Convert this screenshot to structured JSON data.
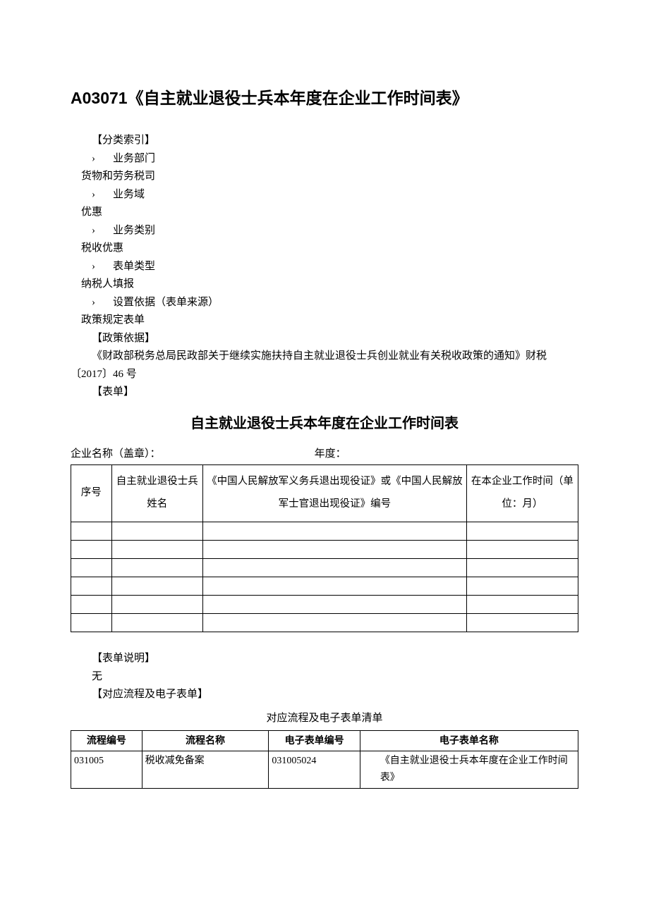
{
  "title": "A03071《自主就业退役士兵本年度在企业工作时间表》",
  "index": {
    "label": "【分类索引】",
    "items": [
      {
        "chev": "›",
        "head": "业务部门",
        "value": "货物和劳务税司"
      },
      {
        "chev": "›",
        "head": "业务域",
        "value": "优惠"
      },
      {
        "chev": "›",
        "head": "业务类别",
        "value": "税收优惠"
      },
      {
        "chev": "›",
        "head": "表单类型",
        "value": "纳税人填报"
      },
      {
        "chev": "›",
        "head": "设置依据（表单来源）",
        "value": "政策规定表单"
      }
    ]
  },
  "policy": {
    "label": "【政策依据】",
    "text": "《财政部税务总局民政部关于继续实施扶持自主就业退役士兵创业就业有关税收政策的通知》财税〔2017〕46 号"
  },
  "form_label": "【表单】",
  "form": {
    "title": "自主就业退役士兵本年度在企业工作时间表",
    "meta_left": "企业名称（盖章）：",
    "meta_right": "年度：",
    "headers": {
      "c1": "序号",
      "c2": "自主就业退役士兵姓名",
      "c3": "《中国人民解放军义务兵退出现役证》或《中国人民解放军士官退出现役证》编号",
      "c4": "在本企业工作时间（单位：月）"
    },
    "empty_rows": 6
  },
  "desc": {
    "label": "【表单说明】",
    "text": "无"
  },
  "mapping": {
    "label": "【对应流程及电子表单】",
    "title": "对应流程及电子表单清单",
    "headers": {
      "h1": "流程编号",
      "h2": "流程名称",
      "h3": "电子表单编号",
      "h4": "电子表单名称"
    },
    "rows": [
      {
        "c1": "031005",
        "c2": "税收减免备案",
        "c3": "031005024",
        "c4": "《自主就业退役士兵本年度在企业工作时间表》"
      }
    ]
  }
}
